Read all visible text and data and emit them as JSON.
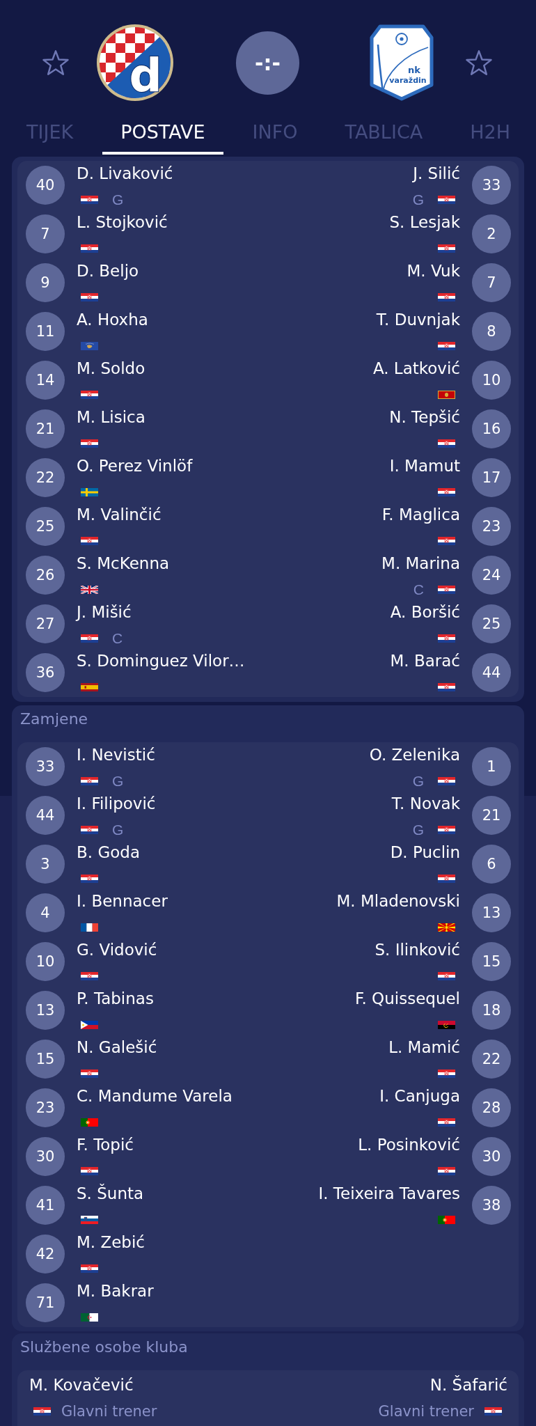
{
  "home_team": {
    "favorite": false,
    "crest": {
      "kind": "checkered-circle",
      "text": [
        "d"
      ]
    }
  },
  "score": "-:-",
  "away_team": {
    "favorite": false,
    "crest": {
      "kind": "shield",
      "text": [
        "nk",
        "varaždin"
      ]
    }
  },
  "tabs": [
    {
      "label": "TIJEK",
      "selected": false
    },
    {
      "label": "POSTAVE",
      "selected": true
    },
    {
      "label": "INFO",
      "selected": false
    },
    {
      "label": "TABLICA",
      "selected": false
    },
    {
      "label": "H2H",
      "selected": false
    }
  ],
  "starters": {
    "rows": [
      {
        "home": {
          "number": "40",
          "name": "D. Livaković",
          "flag": {
            "kind": "croatia"
          },
          "role": "G"
        },
        "away": {
          "number": "33",
          "name": "J. Silić",
          "flag": {
            "kind": "croatia"
          },
          "role": "G"
        }
      },
      {
        "home": {
          "number": "7",
          "name": "L. Stojković",
          "flag": {
            "kind": "croatia"
          }
        },
        "away": {
          "number": "2",
          "name": "S. Lesjak",
          "flag": {
            "kind": "croatia"
          }
        }
      },
      {
        "home": {
          "number": "9",
          "name": "D. Beljo",
          "flag": {
            "kind": "croatia"
          }
        },
        "away": {
          "number": "7",
          "name": "M. Vuk",
          "flag": {
            "kind": "croatia"
          }
        }
      },
      {
        "home": {
          "number": "11",
          "name": "A. Hoxha",
          "flag": {
            "kind": "kosovo"
          }
        },
        "away": {
          "number": "8",
          "name": "T. Duvnjak",
          "flag": {
            "kind": "croatia"
          }
        }
      },
      {
        "home": {
          "number": "14",
          "name": "M. Soldo",
          "flag": {
            "kind": "croatia"
          }
        },
        "away": {
          "number": "10",
          "name": "A. Latković",
          "flag": {
            "kind": "montenegro"
          }
        }
      },
      {
        "home": {
          "number": "21",
          "name": "M. Lisica",
          "flag": {
            "kind": "croatia"
          }
        },
        "away": {
          "number": "16",
          "name": "N. Tepšić",
          "flag": {
            "kind": "croatia"
          }
        }
      },
      {
        "home": {
          "number": "22",
          "name": "O. Perez Vinlöf",
          "flag": {
            "kind": "sweden"
          }
        },
        "away": {
          "number": "17",
          "name": "I. Mamut",
          "flag": {
            "kind": "croatia"
          }
        }
      },
      {
        "home": {
          "number": "25",
          "name": "M. Valinčić",
          "flag": {
            "kind": "croatia"
          }
        },
        "away": {
          "number": "23",
          "name": "F. Maglica",
          "flag": {
            "kind": "croatia"
          }
        }
      },
      {
        "home": {
          "number": "26",
          "name": "S. McKenna",
          "flag": {
            "kind": "britain"
          }
        },
        "away": {
          "number": "24",
          "name": "M. Marina",
          "flag": {
            "kind": "croatia"
          },
          "role": "C"
        }
      },
      {
        "home": {
          "number": "27",
          "name": "J. Mišić",
          "flag": {
            "kind": "croatia"
          },
          "role": "C"
        },
        "away": {
          "number": "25",
          "name": "A. Boršić",
          "flag": {
            "kind": "croatia"
          }
        }
      },
      {
        "home": {
          "number": "36",
          "name": "S. Dominguez Vilor…",
          "flag": {
            "kind": "spain"
          }
        },
        "away": {
          "number": "44",
          "name": "M. Barać",
          "flag": {
            "kind": "croatia"
          }
        }
      }
    ]
  },
  "substitutes": {
    "title": "Zamjene",
    "rows": [
      {
        "home": {
          "number": "33",
          "name": "I. Nevistić",
          "flag": {
            "kind": "croatia"
          },
          "role": "G"
        },
        "away": {
          "number": "1",
          "name": "O. Zelenika",
          "flag": {
            "kind": "croatia"
          },
          "role": "G"
        }
      },
      {
        "home": {
          "number": "44",
          "name": "I. Filipović",
          "flag": {
            "kind": "croatia"
          },
          "role": "G"
        },
        "away": {
          "number": "21",
          "name": "T. Novak",
          "flag": {
            "kind": "croatia"
          },
          "role": "G"
        }
      },
      {
        "home": {
          "number": "3",
          "name": "B. Goda",
          "flag": {
            "kind": "croatia"
          }
        },
        "away": {
          "number": "6",
          "name": "D. Puclin",
          "flag": {
            "kind": "croatia"
          }
        }
      },
      {
        "home": {
          "number": "4",
          "name": "I. Bennacer",
          "flag": {
            "kind": "france"
          }
        },
        "away": {
          "number": "13",
          "name": "M. Mladenovski",
          "flag": {
            "kind": "macedonia"
          }
        }
      },
      {
        "home": {
          "number": "10",
          "name": "G. Vidović",
          "flag": {
            "kind": "croatia"
          }
        },
        "away": {
          "number": "15",
          "name": "S. Ilinković",
          "flag": {
            "kind": "croatia"
          }
        }
      },
      {
        "home": {
          "number": "13",
          "name": "P. Tabinas",
          "flag": {
            "kind": "philippines"
          }
        },
        "away": {
          "number": "18",
          "name": "F. Quissequel",
          "flag": {
            "kind": "angola"
          }
        }
      },
      {
        "home": {
          "number": "15",
          "name": "N. Galešić",
          "flag": {
            "kind": "croatia"
          }
        },
        "away": {
          "number": "22",
          "name": "L. Mamić",
          "flag": {
            "kind": "croatia"
          }
        }
      },
      {
        "home": {
          "number": "23",
          "name": "C. Mandume Varela",
          "flag": {
            "kind": "portugal"
          }
        },
        "away": {
          "number": "28",
          "name": "I. Canjuga",
          "flag": {
            "kind": "croatia"
          }
        }
      },
      {
        "home": {
          "number": "30",
          "name": "F. Topić",
          "flag": {
            "kind": "croatia"
          }
        },
        "away": {
          "number": "30",
          "name": "L. Posinković",
          "flag": {
            "kind": "croatia"
          }
        }
      },
      {
        "home": {
          "number": "41",
          "name": "S. Šunta",
          "flag": {
            "kind": "slovenia"
          }
        },
        "away": {
          "number": "38",
          "name": "I. Teixeira Tavares",
          "flag": {
            "kind": "portugal"
          }
        }
      },
      {
        "home": {
          "number": "42",
          "name": "M. Zebić",
          "flag": {
            "kind": "croatia"
          }
        }
      },
      {
        "home": {
          "number": "71",
          "name": "M. Bakrar",
          "flag": {
            "kind": "algeria"
          }
        }
      }
    ]
  },
  "officials": {
    "title": "Službene osobe kluba",
    "rows": [
      {
        "home": {
          "name": "M. Kovačević",
          "flag": {
            "kind": "croatia"
          },
          "role": "Glavni trener"
        },
        "away": {
          "name": "N. Šafarić",
          "flag": {
            "kind": "croatia"
          },
          "role": "Glavni trener"
        }
      }
    ]
  }
}
